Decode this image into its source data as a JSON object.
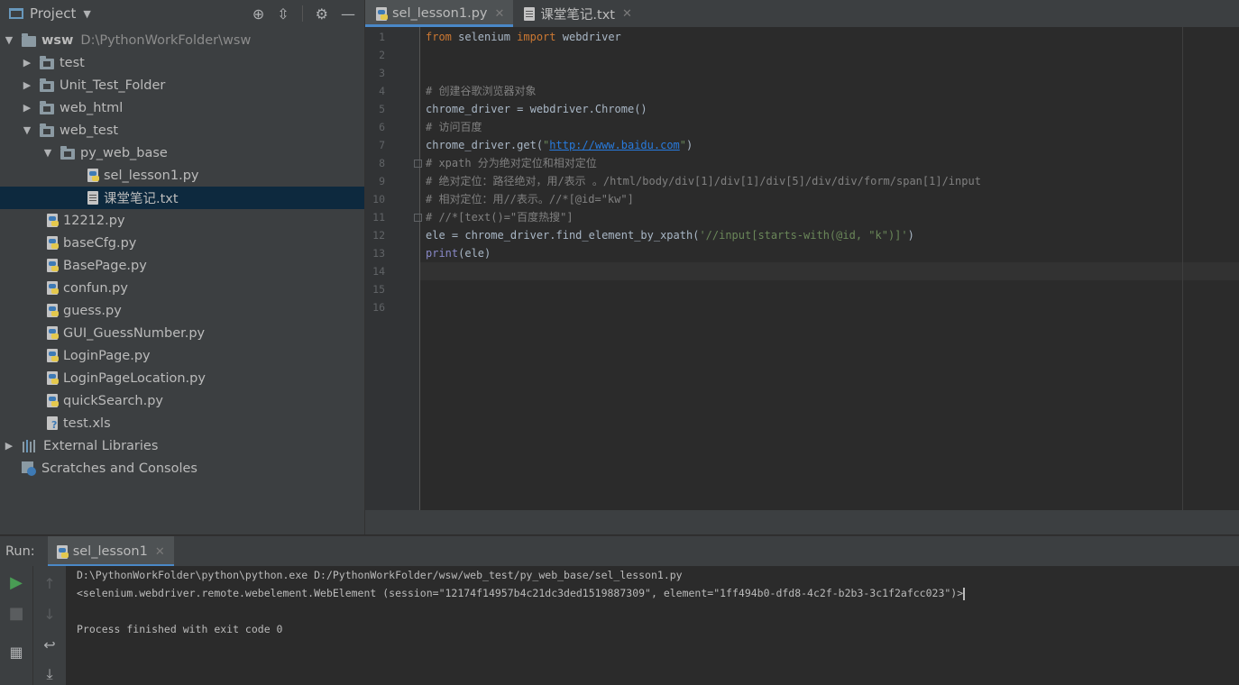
{
  "project": {
    "title": "Project",
    "tree": [
      {
        "label": "wsw",
        "path": "D:\\PythonWorkFolder\\wsw"
      },
      {
        "label": "test"
      },
      {
        "label": "Unit_Test_Folder"
      },
      {
        "label": "web_html"
      },
      {
        "label": "web_test"
      },
      {
        "label": "py_web_base"
      },
      {
        "label": "sel_lesson1.py"
      },
      {
        "label": "课堂笔记.txt"
      },
      {
        "label": "12212.py"
      },
      {
        "label": "baseCfg.py"
      },
      {
        "label": "BasePage.py"
      },
      {
        "label": "confun.py"
      },
      {
        "label": "guess.py"
      },
      {
        "label": "GUI_GuessNumber.py"
      },
      {
        "label": "LoginPage.py"
      },
      {
        "label": "LoginPageLocation.py"
      },
      {
        "label": "quickSearch.py"
      },
      {
        "label": "test.xls"
      },
      {
        "label": "External Libraries"
      },
      {
        "label": "Scratches and Consoles"
      }
    ]
  },
  "editor": {
    "tabs": [
      {
        "label": "sel_lesson1.py",
        "active": true
      },
      {
        "label": "课堂笔记.txt",
        "active": false
      }
    ],
    "line_numbers": [
      "1",
      "2",
      "3",
      "4",
      "5",
      "6",
      "7",
      "8",
      "9",
      "10",
      "11",
      "12",
      "13",
      "14",
      "15",
      "16"
    ],
    "code": {
      "l1_kw1": "from",
      "l1_mid": " selenium ",
      "l1_kw2": "import",
      "l1_end": " webdriver",
      "l4": "# 创建谷歌浏览器对象",
      "l5": "chrome_driver = webdriver.Chrome()",
      "l6": "# 访问百度",
      "l7_a": "chrome_driver.get(",
      "l7_q1": "\"",
      "l7_url": "http://www.baidu.com",
      "l7_q2": "\"",
      "l7_b": ")",
      "l8": "# xpath 分为绝对定位和相对定位",
      "l9": "# 绝对定位：路径绝对，用/表示 。/html/body/div[1]/div[1]/div[5]/div/div/form/span[1]/input",
      "l10": "# 相对定位：用//表示。//*[@id=\"kw\"]",
      "l11": "# //*[text()=\"百度热搜\"]",
      "l12_a": "ele = chrome_driver.find_element_by_xpath(",
      "l12_s": "'//input[starts-with(@id, \"k\")]'",
      "l12_b": ")",
      "l13_fn": "print",
      "l13_rest": "(ele)"
    }
  },
  "run": {
    "label": "Run:",
    "tab": "sel_lesson1",
    "output": [
      "D:\\PythonWorkFolder\\python\\python.exe D:/PythonWorkFolder/wsw/web_test/py_web_base/sel_lesson1.py",
      "<selenium.webdriver.remote.webelement.WebElement (session=\"12174f14957b4c21dc3ded1519887309\", element=\"1ff494b0-dfd8-4c2f-b2b3-3c1f2afcc023\")>",
      "",
      "Process finished with exit code 0"
    ]
  },
  "colors": {
    "keyword": "#cc7832",
    "comment": "#808080",
    "string": "#6a8759",
    "link": "#287bde",
    "selection": "#0d293e",
    "run_green": "#499c54"
  }
}
